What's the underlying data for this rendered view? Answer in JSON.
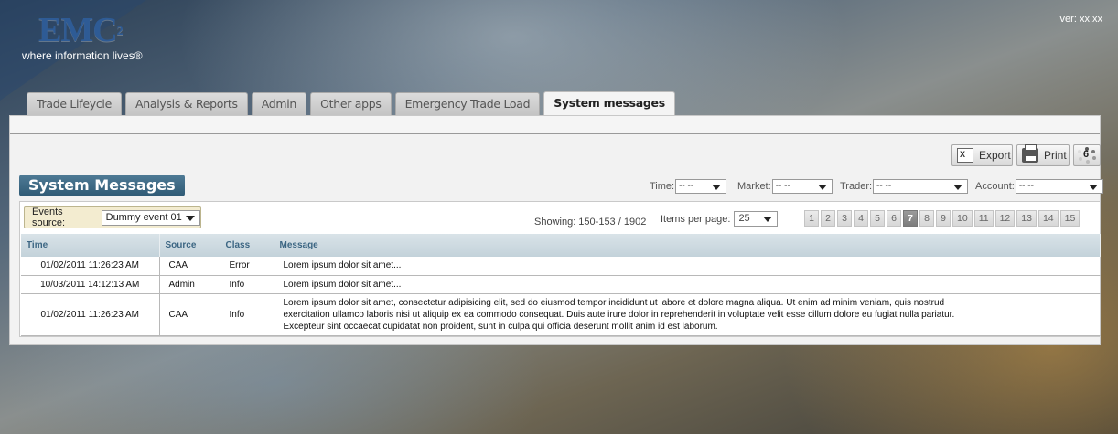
{
  "logo": {
    "word": "EMC",
    "superscript": "2",
    "tagline": "where information lives®"
  },
  "version": "ver: xx.xx",
  "tabs": [
    {
      "label": "Trade Lifeycle",
      "active": false
    },
    {
      "label": "Analysis & Reports",
      "active": false
    },
    {
      "label": "Admin",
      "active": false
    },
    {
      "label": "Other apps",
      "active": false
    },
    {
      "label": "Emergency Trade Load",
      "active": false
    },
    {
      "label": "System messages",
      "active": true
    }
  ],
  "toolbar": {
    "export_label": "Export",
    "print_label": "Print",
    "loader_count": "6",
    "icons": {
      "export": "excel-export-icon",
      "print": "printer-icon",
      "loader": "spinner-icon"
    }
  },
  "section_title": "System Messages",
  "filters": {
    "time": {
      "label": "Time:",
      "value": "-- --"
    },
    "market": {
      "label": "Market:",
      "value": "-- --"
    },
    "trader": {
      "label": "Trader:",
      "value": "-- --"
    },
    "account": {
      "label": "Account:",
      "value": "-- --"
    }
  },
  "events_source": {
    "label": "Events source:",
    "value": "Dummy event 01"
  },
  "showing": "Showing: 150-153 / 1902",
  "items_per_page": {
    "label": "Items per page:",
    "value": "25"
  },
  "pager": {
    "pages": [
      "1",
      "2",
      "3",
      "4",
      "5",
      "6",
      "7",
      "8",
      "9",
      "10",
      "11",
      "12",
      "13",
      "14",
      "15"
    ],
    "current": "7"
  },
  "table": {
    "columns": [
      "Time",
      "Source",
      "Class",
      "Message"
    ],
    "rows": [
      {
        "time": "01/02/2011 11:26:23 AM",
        "source": "CAA",
        "class": "Error",
        "message": "Lorem ipsum dolor sit amet..."
      },
      {
        "time": "10/03/2011 14:12:13 AM",
        "source": "Admin",
        "class": "Info",
        "message": "Lorem ipsum dolor sit amet..."
      },
      {
        "time": "01/02/2011 11:26:23 AM",
        "source": "CAA",
        "class": "Info",
        "message_lines": [
          "Lorem ipsum dolor sit amet, consectetur adipisicing elit, sed do eiusmod tempor incididunt ut labore et dolore magna aliqua. Ut enim ad minim veniam, quis nostrud",
          "exercitation ullamco laboris nisi ut aliquip ex ea commodo consequat. Duis aute irure dolor in reprehenderit in voluptate velit esse cillum dolore eu fugiat nulla pariatur.",
          "Excepteur sint occaecat cupidatat non proident, sunt in culpa qui officia deserunt mollit anim id est laborum."
        ]
      }
    ]
  },
  "colors": {
    "accent": "#2f5a75",
    "header_text": "#3c6683",
    "events_bg": "#f3ecd0",
    "logo_blue": "#2e5b95"
  }
}
